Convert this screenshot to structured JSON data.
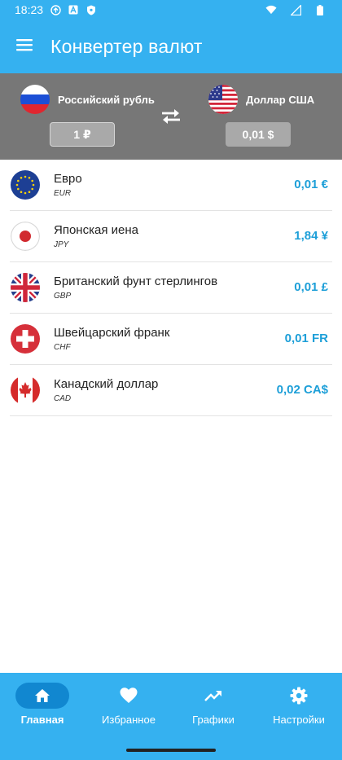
{
  "status_bar": {
    "time": "18:23"
  },
  "app_bar": {
    "title": "Конвертер валют"
  },
  "converter": {
    "from": {
      "name": "Российский рубль",
      "amount": "1 ₽",
      "flag": "russia-flag"
    },
    "to": {
      "name": "Доллар США",
      "amount": "0,01 $",
      "flag": "usa-flag"
    }
  },
  "currencies": [
    {
      "name": "Евро",
      "code": "EUR",
      "value": "0,01 €",
      "flag": "eu-flag"
    },
    {
      "name": "Японская иена",
      "code": "JPY",
      "value": "1,84 ¥",
      "flag": "japan-flag"
    },
    {
      "name": "Британский фунт стерлингов",
      "code": "GBP",
      "value": "0,01 £",
      "flag": "uk-flag"
    },
    {
      "name": "Швейцарский франк",
      "code": "CHF",
      "value": "0,01 FR",
      "flag": "switzerland-flag"
    },
    {
      "name": "Канадский доллар",
      "code": "CAD",
      "value": "0,02 CA$",
      "flag": "canada-flag"
    }
  ],
  "nav": {
    "items": [
      {
        "label": "Главная",
        "icon": "home-icon",
        "active": true
      },
      {
        "label": "Избранное",
        "icon": "heart-icon",
        "active": false
      },
      {
        "label": "Графики",
        "icon": "trending-up-icon",
        "active": false
      },
      {
        "label": "Настройки",
        "icon": "gear-icon",
        "active": false
      }
    ]
  },
  "colors": {
    "primary": "#35b1f0",
    "panel": "#777777",
    "value": "#1d9fd8",
    "nav_active": "#1187d0"
  }
}
